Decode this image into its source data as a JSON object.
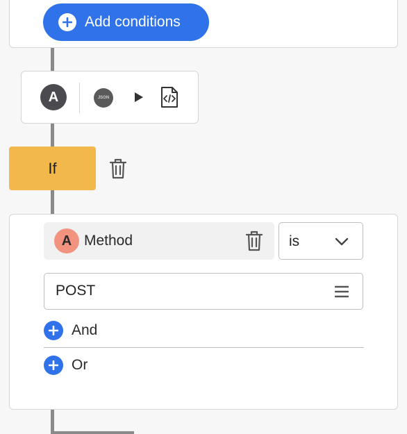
{
  "top_card": {
    "add_conditions_label": "Add conditions"
  },
  "step": {
    "avatar_letter": "A",
    "json_label": "JSON"
  },
  "if_block": {
    "label": "If"
  },
  "condition": {
    "field_avatar_letter": "A",
    "field_label": "Method",
    "operator": "is",
    "value": "POST",
    "and_label": "And",
    "or_label": "Or"
  },
  "icons": [
    "plus-icon",
    "json-icon",
    "play-icon",
    "code-file-icon",
    "trash-icon",
    "chevron-down-icon",
    "menu-icon"
  ],
  "colors": {
    "accent": "#2f72e9",
    "if_block": "#f2b84b",
    "avatar_dark": "#4b4b4f",
    "avatar_field": "#f1937f"
  }
}
